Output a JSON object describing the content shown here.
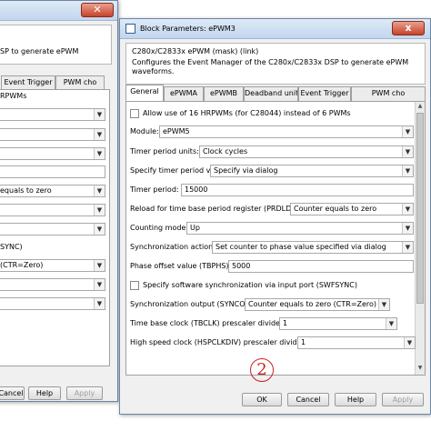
{
  "back_window": {
    "description_line1": "SP to generate ePWM",
    "tab_event_trigger": "Event Trigger",
    "tab_pwm_chop": "PWM cho",
    "text_hrpwms": "RPWMs",
    "label_equals_zero": "equals to zero",
    "label_sync": "SYNC)",
    "label_ctr_zero": "(CTR=Zero)",
    "btn_cancel": "Cancel",
    "btn_help": "Help",
    "btn_apply": "Apply"
  },
  "front_window": {
    "title": "Block Parameters: ePWM3",
    "close_icon": "x",
    "desc_title": "C280x/C2833x ePWM (mask) (link)",
    "desc_body": "Configures the Event Manager of the C280x/C2833x DSP to generate ePWM waveforms.",
    "tabs": [
      "General",
      "ePWMA",
      "ePWMB",
      "Deadband unit",
      "Event Trigger",
      "PWM cho"
    ],
    "active_tab": "General",
    "fields": {
      "hrpwm_label": "Allow use of 16 HRPWMs (for C28044) instead of 6 PWMs",
      "module_label": "Module:",
      "module_value": "ePWM5",
      "timer_units_label": "Timer period units:",
      "timer_units_value": "Clock cycles",
      "timer_via_label": "Specify timer period via:",
      "timer_via_value": "Specify via dialog",
      "timer_period_label": "Timer period:",
      "timer_period_value": "15000",
      "reload_label": "Reload for time base period register (PRDLD):",
      "reload_value": "Counter equals to zero",
      "counting_label": "Counting mode:",
      "counting_value": "Up",
      "sync_action_label": "Synchronization action:",
      "sync_action_value": "Set counter to phase value specified via dialog",
      "phase_label": "Phase offset value (TBPHS):",
      "phase_value": "5000",
      "sw_sync_label": "Specify software synchronization via input port (SWFSYNC)",
      "sync_output_label": "Synchronization output (SYNCO):",
      "sync_output_value": "Counter equals to zero (CTR=Zero)",
      "tbclk_label": "Time base clock (TBCLK) prescaler divider:",
      "tbclk_value": "1",
      "hsp_label": "High speed clock (HSPCLKDIV) prescaler divider:",
      "hsp_value": "1"
    },
    "annotation": "2",
    "buttons": {
      "ok": "OK",
      "cancel": "Cancel",
      "help": "Help",
      "apply": "Apply"
    }
  }
}
